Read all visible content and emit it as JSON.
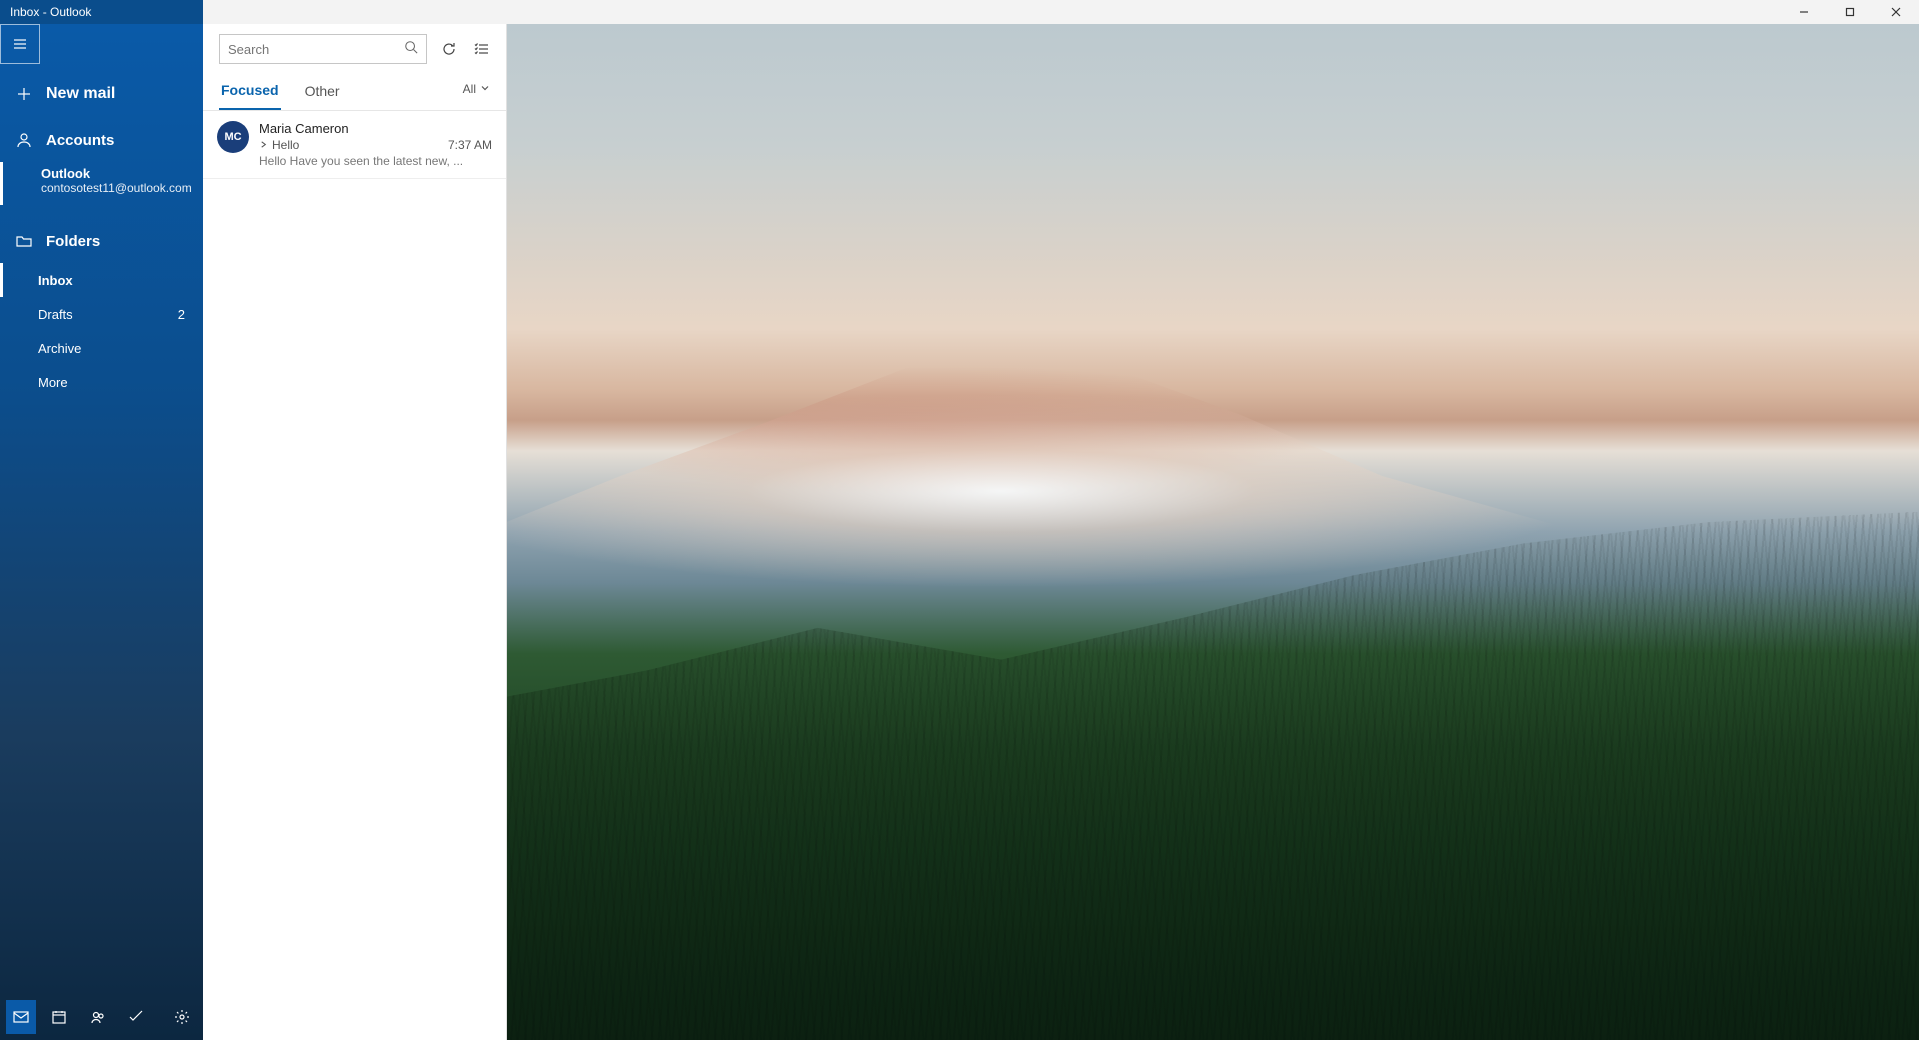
{
  "window": {
    "title": "Inbox - Outlook"
  },
  "sidebar": {
    "new_mail": "New mail",
    "accounts_label": "Accounts",
    "account": {
      "name": "Outlook",
      "email": "contosotest11@outlook.com"
    },
    "folders_label": "Folders",
    "folders": [
      {
        "name": "Inbox",
        "count": ""
      },
      {
        "name": "Drafts",
        "count": "2"
      },
      {
        "name": "Archive",
        "count": ""
      },
      {
        "name": "More",
        "count": ""
      }
    ]
  },
  "list": {
    "search_placeholder": "Search",
    "tabs": {
      "focused": "Focused",
      "other": "Other"
    },
    "filter_label": "All",
    "messages": [
      {
        "initials": "MC",
        "sender": "Maria Cameron",
        "subject": "Hello",
        "time": "7:37 AM",
        "preview": "Hello Have you seen the latest new, ..."
      }
    ]
  }
}
